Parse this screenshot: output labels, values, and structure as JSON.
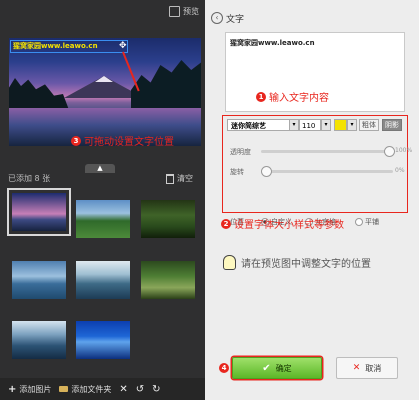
{
  "left_panel": {
    "preview_label": "预览",
    "watermark_text": "猩窝家园www.leawo.cn",
    "annotation_3": {
      "num": "3",
      "text": "可拖动设置文字位置"
    },
    "added_count": "已添加 8 张",
    "clear_label": "清空",
    "bottom_bar": {
      "add_image": "添加图片",
      "add_folder": "添加文件夹"
    }
  },
  "right_panel": {
    "title": "文字",
    "text_value": "猩窝家园www.leawo.cn",
    "annotation_1": {
      "num": "1",
      "text": "输入文字内容"
    },
    "font": {
      "family": "迷你简综艺",
      "size": "110",
      "color": "#f4e200",
      "bold_label": "粗体",
      "shadow_label": "阴影"
    },
    "opacity": {
      "label": "透明度",
      "value": "100%",
      "level": 100
    },
    "rotation": {
      "label": "旋转",
      "value": "0%",
      "level": 0
    },
    "position": {
      "label": "位置",
      "options": [
        "自定义",
        "九宫格",
        "平铺"
      ],
      "selected": "自定义"
    },
    "annotation_2": {
      "num": "2",
      "text": "设置字体大小样式等参数"
    },
    "hint": "请在预览图中调整文字的位置",
    "ok_label": "确定",
    "cancel_label": "取消",
    "annotation_4": {
      "num": "4"
    }
  }
}
